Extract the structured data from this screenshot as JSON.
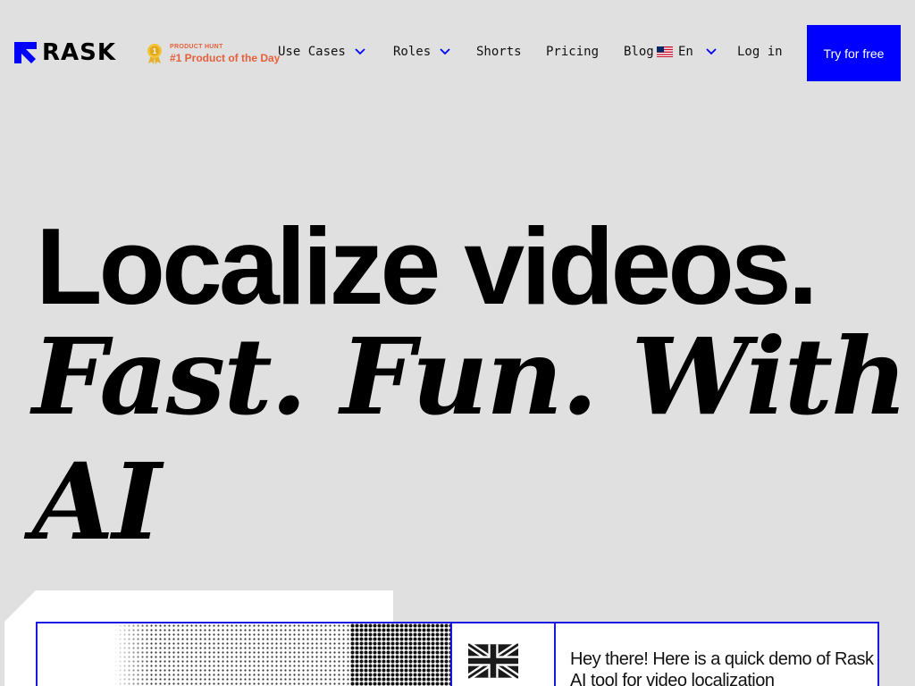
{
  "brand": {
    "logo_text": "RASK",
    "accent_color": "#0000ff"
  },
  "product_hunt": {
    "label_small": "PRODUCT HUNT",
    "label_big": "#1 Product of the Day",
    "color": "#e5603c"
  },
  "nav": {
    "use_cases": "Use Cases",
    "roles": "Roles",
    "shorts": "Shorts",
    "pricing": "Pricing",
    "blog": "Blog",
    "language": "En",
    "login": "Log in",
    "cta": "Try for free"
  },
  "hero": {
    "line1": "Localize videos.",
    "line2": "Fast. Fun. With AI"
  },
  "demo": {
    "message": "Hey there! Here is a quick demo of Rask AI tool for video localization"
  }
}
